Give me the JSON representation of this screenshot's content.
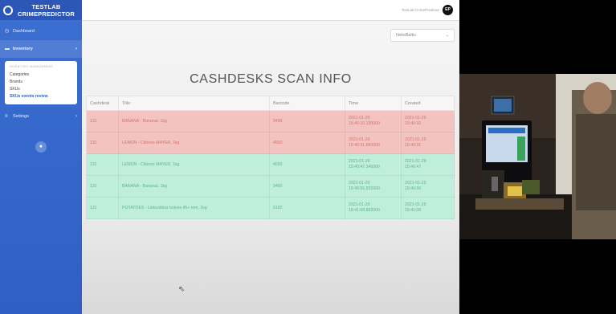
{
  "brand": {
    "line1": "TESTLAB",
    "line2": "CRIMEPREDICTOR"
  },
  "sidebar": {
    "items": [
      {
        "label": "Dashboard",
        "icon": "dashboard-icon"
      },
      {
        "label": "Inventory",
        "icon": "inventory-icon"
      },
      {
        "label": "Settings",
        "icon": "settings-icon"
      }
    ],
    "submenu": {
      "heading": "INVENTORY MANAGEMENT",
      "links": [
        "Categories",
        "Brands",
        "SKUs",
        "SKUs events review"
      ]
    }
  },
  "topbar": {
    "user_name": "TestLab CrimePredictor",
    "avatar_initials": "EP"
  },
  "store_select": {
    "value": "NetoBaltic"
  },
  "page": {
    "title": "CASHDESKS SCAN INFO"
  },
  "table": {
    "columns": [
      "Cashdesk",
      "Title",
      "Barcode",
      "Time",
      "Created"
    ],
    "rows": [
      {
        "status": "red",
        "cashdesk": "131",
        "title": "BANANA - Bananai, 1kg",
        "barcode": "9495",
        "time_date": "2021-01-29",
        "time_clock": "15:40:10.139000",
        "created_date": "2021-01-29",
        "created_clock": "15:40:10"
      },
      {
        "status": "red",
        "cashdesk": "131",
        "title": "LEMON - Citrinos MAYER, 1kg",
        "barcode": "4550",
        "time_date": "2021-01-29",
        "time_clock": "15:40:31.660000",
        "created_date": "2021-01-29",
        "created_clock": "15:40:31"
      },
      {
        "status": "green",
        "cashdesk": "131",
        "title": "LEMON - Citrinos MAYER, 1kg",
        "barcode": "4550",
        "time_date": "2021-01-29",
        "time_clock": "15:40:47.346000",
        "created_date": "2021-01-29",
        "created_clock": "15:40:47"
      },
      {
        "status": "green",
        "cashdesk": "131",
        "title": "BANANA - Bananai, 1kg",
        "barcode": "9495",
        "time_date": "2021-01-29",
        "time_clock": "15:40:56.832000",
        "created_date": "2021-01-29",
        "created_clock": "15:40:56"
      },
      {
        "status": "green",
        "cashdesk": "131",
        "title": "POTATOES - Lietuviškos bulvės 45+ mm, 1kg",
        "barcode": "5182",
        "time_date": "2021-01-29",
        "time_clock": "15:41:08.892000",
        "created_date": "2021-01-29",
        "created_clock": "15:41:08"
      }
    ]
  },
  "colors": {
    "sidebar": "#3b6fd1",
    "row_red": "#f2c3c0",
    "row_green": "#bfeedc"
  }
}
